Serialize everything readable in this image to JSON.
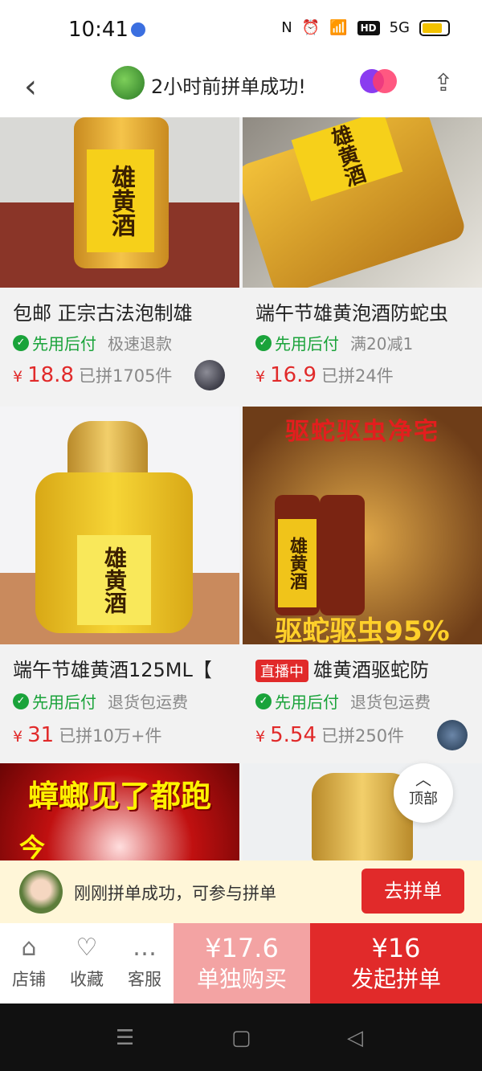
{
  "status": {
    "time": "10:41",
    "network": "5G",
    "hd": "HD"
  },
  "header": {
    "title": "2小时前拼单成功!"
  },
  "products": [
    {
      "title": "包邮 正宗古法泡制雄",
      "pay_tag": "先用后付",
      "tag2": "极速退款",
      "currency": "¥",
      "price": "18.8",
      "sold": "已拼1705件",
      "label": "雄黄酒"
    },
    {
      "title": "端午节雄黄泡酒防蛇虫",
      "pay_tag": "先用后付",
      "tag2": "满20减1",
      "currency": "¥",
      "price": "16.9",
      "sold": "已拼24件",
      "label": "雄黄酒"
    },
    {
      "title": "端午节雄黄酒125ML【",
      "pay_tag": "先用后付",
      "tag2": "退货包运费",
      "currency": "¥",
      "price": "31",
      "sold": "已拼10万+件",
      "label": "雄黄酒"
    },
    {
      "live": "直播中",
      "title": "雄黄酒驱蛇防",
      "pay_tag": "先用后付",
      "tag2": "退货包运费",
      "currency": "¥",
      "price": "5.54",
      "sold": "已拼250件",
      "banner": "驱蛇驱虫净宅",
      "banner2": "驱蛇驱虫95%",
      "label": "雄黄酒"
    },
    {
      "banner": "蟑螂见了都跑",
      "banner2": "今"
    },
    {}
  ],
  "back_to_top": "顶部",
  "group_bar": {
    "message": "刚刚拼单成功，可参与拼单",
    "button": "去拼单"
  },
  "actions": {
    "shop": "店铺",
    "favorite": "收藏",
    "service": "客服"
  },
  "buy_solo": {
    "price": "¥17.6",
    "label": "单独购买"
  },
  "buy_group": {
    "price": "¥16",
    "label": "发起拼单"
  }
}
